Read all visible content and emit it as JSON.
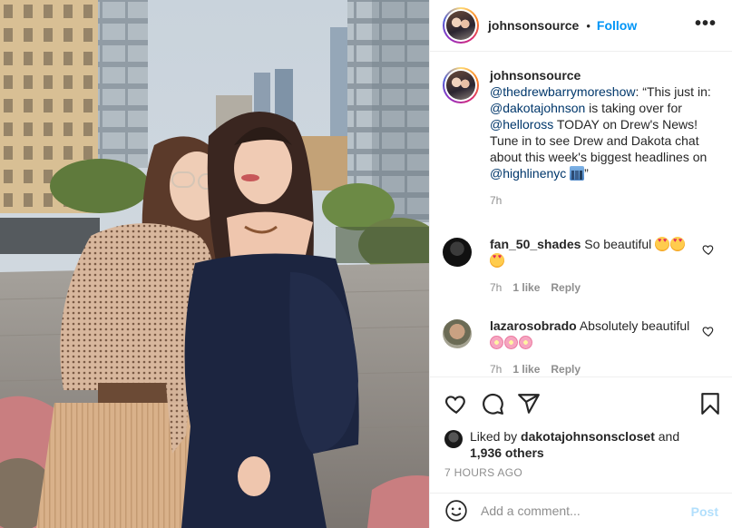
{
  "post_author": {
    "username": "johnsonsource",
    "separator": "•",
    "follow_label": "Follow",
    "more_icon": "more-horizontal-icon"
  },
  "caption": {
    "username": "johnsonsource",
    "parts": {
      "m1": "@thedrewbarrymoreshow",
      "t1": ": “This just in: ",
      "m2": "@dakotajohnson",
      "t2": " is taking over for ",
      "m3": "@helloross",
      "t3": " TODAY on Drew's News! Tune in to see Drew and Dakota chat about this week's biggest headlines on ",
      "m4": "@highlinenyc",
      "t4": "”"
    },
    "emoji": "cityscape-emoji",
    "time": "7h"
  },
  "comments": [
    {
      "username": "fan_50_shades",
      "text": "So beautiful",
      "emoji": "heart-eyes-emoji",
      "time": "7h",
      "likes": "1 like",
      "reply": "Reply"
    },
    {
      "username": "lazarosobrado",
      "text": "Absolutely beautiful",
      "emoji": "cherry-blossom-emoji",
      "time": "7h",
      "likes": "1 like",
      "reply": "Reply"
    }
  ],
  "actions": {
    "like_icon": "heart-icon",
    "comment_icon": "comment-icon",
    "share_icon": "share-icon",
    "save_icon": "bookmark-icon"
  },
  "likes": {
    "prefix": "Liked by",
    "user": "dakotajohnsonscloset",
    "joiner": "and",
    "count": "1,936 others"
  },
  "posted_ago": "7 HOURS AGO",
  "add_comment": {
    "placeholder": "Add a comment...",
    "post_label": "Post",
    "emoji_icon": "smiley-icon"
  },
  "colors": {
    "link_blue": "#0095f6",
    "mention_blue": "#00376b",
    "muted": "#8e8e8e",
    "post_disabled": "#b2dffc"
  }
}
